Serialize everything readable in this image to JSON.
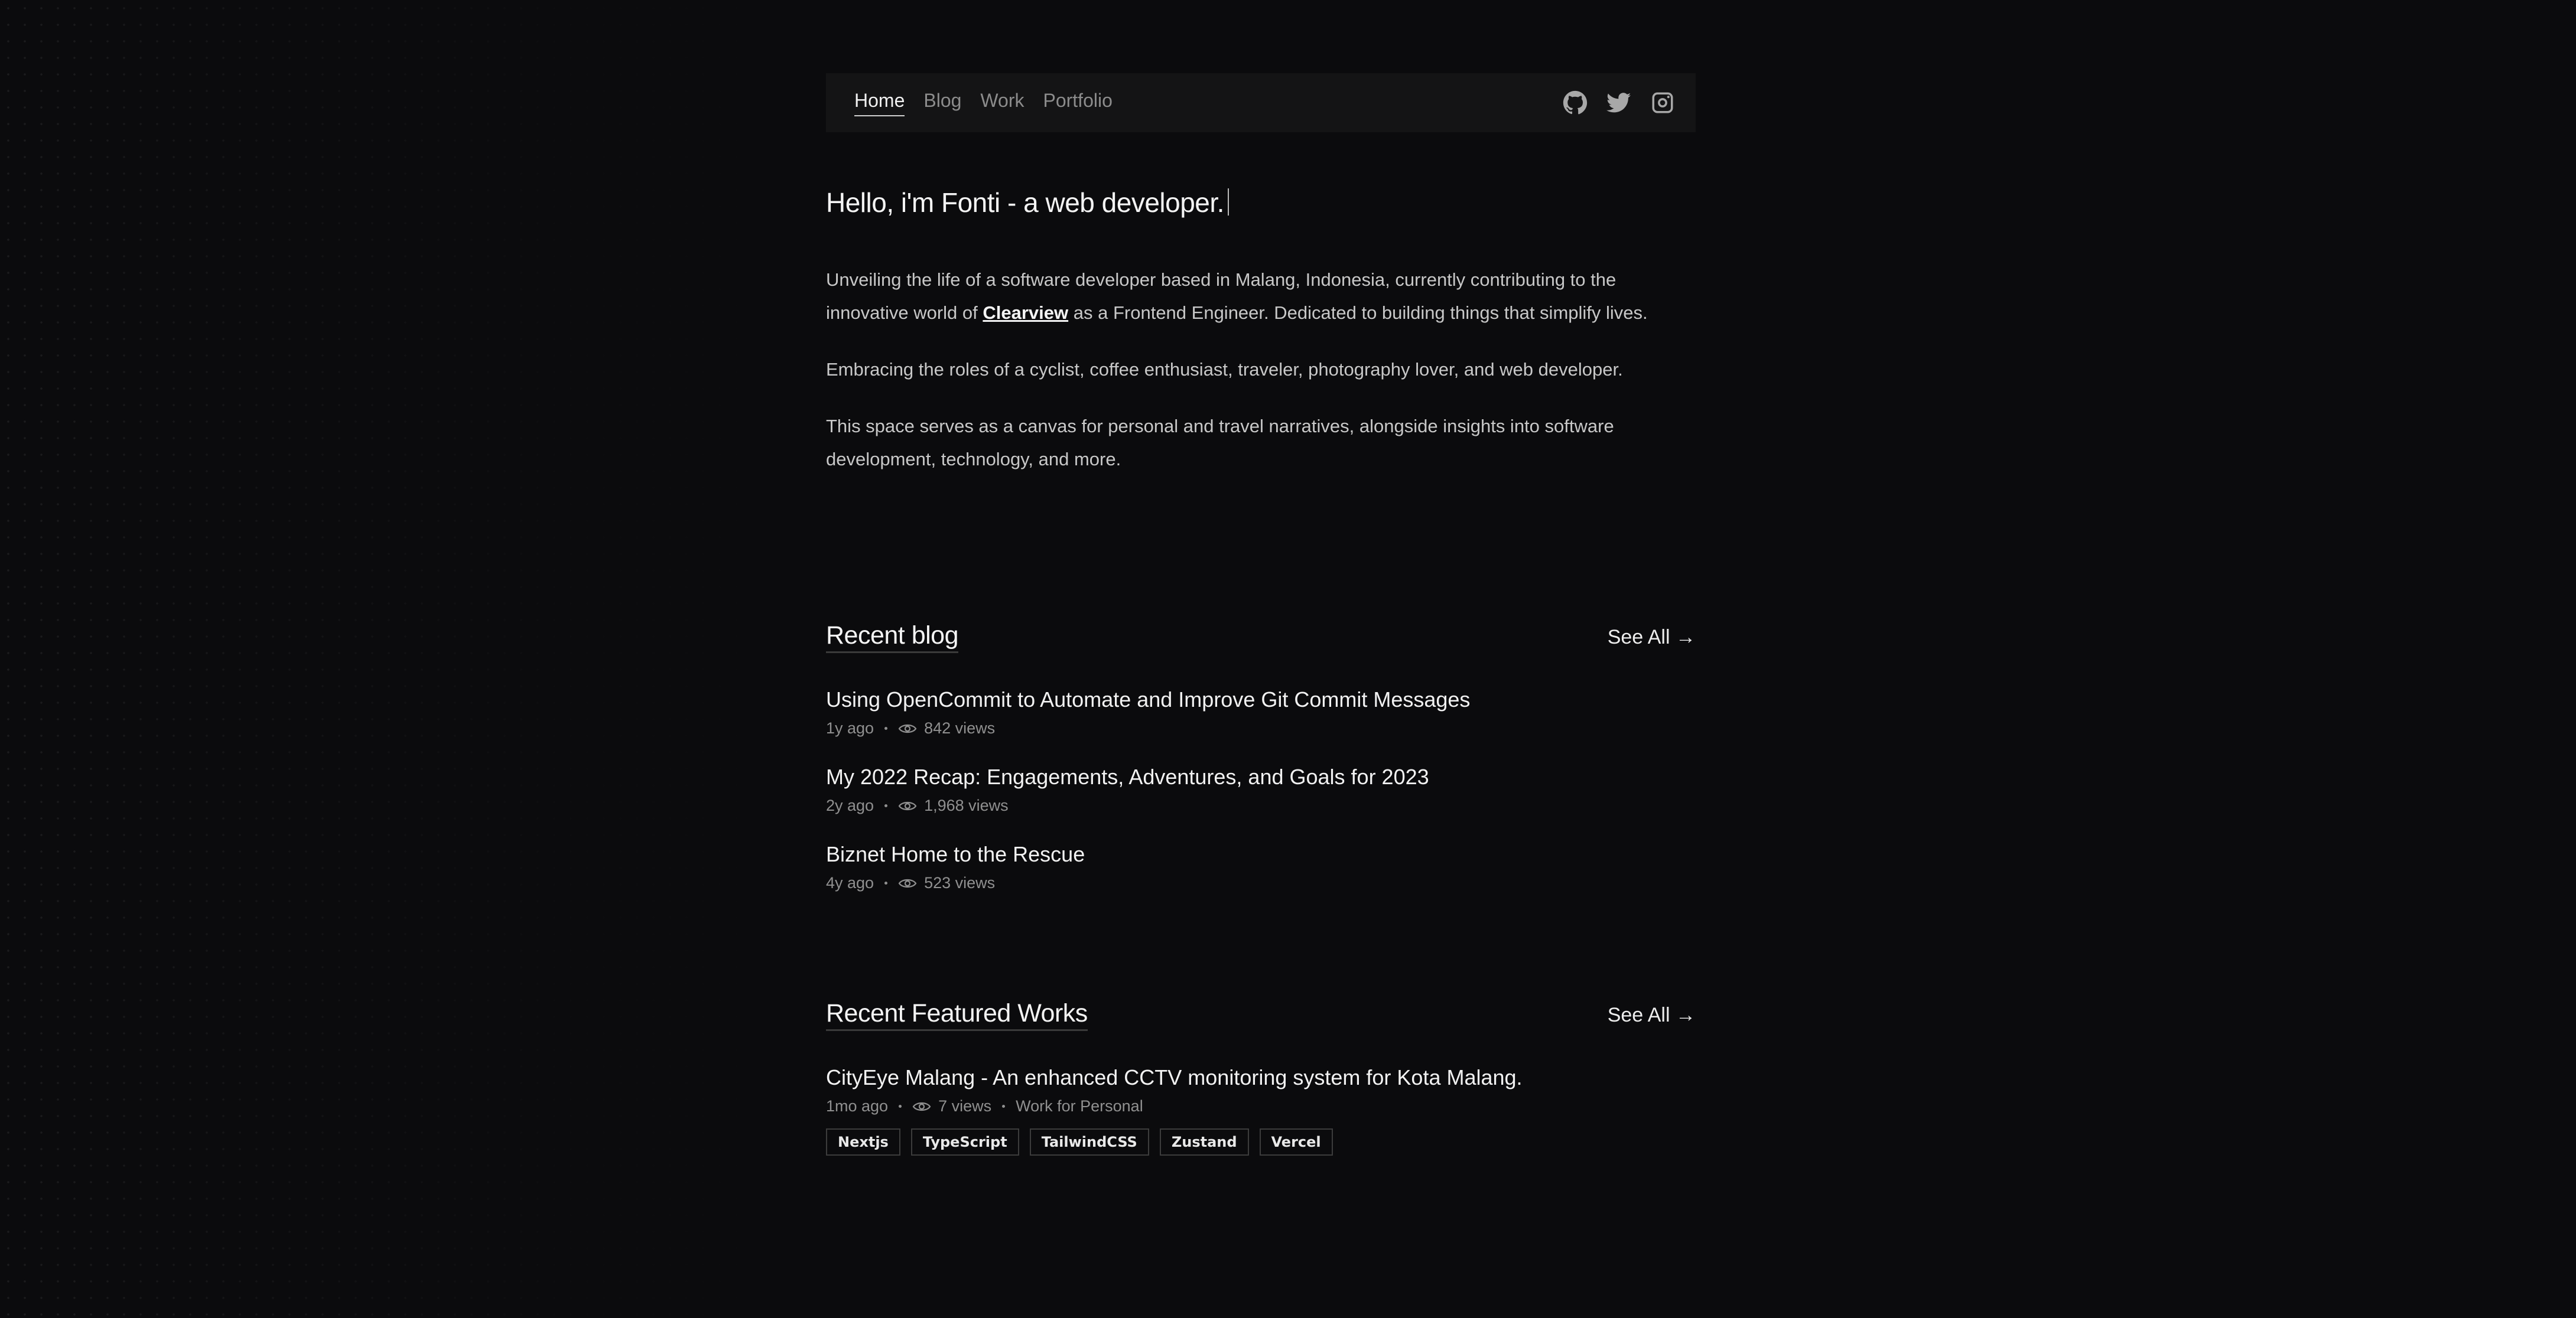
{
  "nav": {
    "links": [
      {
        "label": "Home",
        "active": true
      },
      {
        "label": "Blog",
        "active": false
      },
      {
        "label": "Work",
        "active": false
      },
      {
        "label": "Portfolio",
        "active": false
      }
    ],
    "icons": [
      "github-icon",
      "twitter-icon",
      "instagram-icon"
    ]
  },
  "hero": {
    "title": "Hello, i'm Fonti - a web developer.",
    "p1_before": "Unveiling the life of a software developer based in Malang, Indonesia, currently contributing to the innovative world of ",
    "p1_link": "Clearview",
    "p1_after": " as a Frontend Engineer. Dedicated to building things that simplify lives.",
    "p2": "Embracing the roles of a cyclist, coffee enthusiast, traveler, photography lover, and web developer.",
    "p3": "This space serves as a canvas for personal and travel narratives, alongside insights into software development, technology, and more."
  },
  "blog": {
    "title": "Recent blog",
    "see_all": "See All →",
    "posts": [
      {
        "title": "Using OpenCommit to Automate and Improve Git Commit Messages",
        "age": "1y ago",
        "views": "842 views"
      },
      {
        "title": "My 2022 Recap: Engagements, Adventures, and Goals for 2023",
        "age": "2y ago",
        "views": "1,968 views"
      },
      {
        "title": "Biznet Home to the Rescue",
        "age": "4y ago",
        "views": "523 views"
      }
    ]
  },
  "works": {
    "title": "Recent Featured Works",
    "see_all": "See All →",
    "items": [
      {
        "title": "CityEye Malang - An enhanced CCTV monitoring system for Kota Malang.",
        "age": "1mo ago",
        "views": "7 views",
        "category": "Work for Personal",
        "tags": [
          "Nextjs",
          "TypeScript",
          "TailwindCSS",
          "Zustand",
          "Vercel"
        ]
      }
    ]
  },
  "colors": {
    "background": "#0b0b0d",
    "nav_bg": "#141415",
    "text": "#e6e6e6",
    "muted": "#909090"
  }
}
